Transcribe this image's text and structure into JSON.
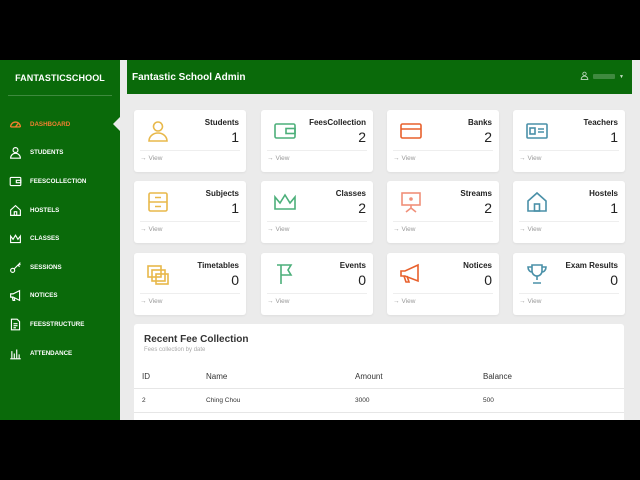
{
  "sidebar": {
    "brand": "FANTASTICSCHOOL",
    "items": [
      {
        "label": "DASHBOARD",
        "icon": "dashboard-gauge-icon",
        "active": true
      },
      {
        "label": "STUDENTS",
        "icon": "user-icon"
      },
      {
        "label": "FEESCOLLECTION",
        "icon": "wallet-icon"
      },
      {
        "label": "HOSTELS",
        "icon": "home-icon"
      },
      {
        "label": "CLASSES",
        "icon": "crown-icon"
      },
      {
        "label": "SESSIONS",
        "icon": "key-icon"
      },
      {
        "label": "NOTICES",
        "icon": "megaphone-icon"
      },
      {
        "label": "FEESSTRUCTURE",
        "icon": "document-icon"
      },
      {
        "label": "ATTENDANCE",
        "icon": "bar-chart-icon"
      }
    ]
  },
  "header": {
    "title": "Fantastic School Admin",
    "user_icon": "user-icon",
    "caret_icon": "caret-down-icon"
  },
  "colors": {
    "brand_green": "#0a6a0a",
    "active_orange": "#f08030",
    "yellow": "#e8b84a",
    "green": "#4caf7a",
    "orange": "#e8602c",
    "salmon": "#f0907a",
    "teal": "#4a90a8"
  },
  "cards": [
    {
      "label": "Students",
      "value": "1",
      "icon": "student-icon",
      "view": "View"
    },
    {
      "label": "FeesCollection",
      "value": "2",
      "icon": "wallet-icon",
      "view": "View"
    },
    {
      "label": "Banks",
      "value": "2",
      "icon": "credit-card-icon",
      "view": "View"
    },
    {
      "label": "Teachers",
      "value": "1",
      "icon": "id-card-icon",
      "view": "View"
    },
    {
      "label": "Subjects",
      "value": "1",
      "icon": "drawer-icon",
      "view": "View"
    },
    {
      "label": "Classes",
      "value": "2",
      "icon": "crown-icon",
      "view": "View"
    },
    {
      "label": "Streams",
      "value": "2",
      "icon": "easel-icon",
      "view": "View"
    },
    {
      "label": "Hostels",
      "value": "1",
      "icon": "home-icon",
      "view": "View"
    },
    {
      "label": "Timetables",
      "value": "0",
      "icon": "copy-icon",
      "view": "View"
    },
    {
      "label": "Events",
      "value": "0",
      "icon": "flag-icon",
      "view": "View"
    },
    {
      "label": "Notices",
      "value": "0",
      "icon": "megaphone-icon",
      "view": "View"
    },
    {
      "label": "Exam Results",
      "value": "0",
      "icon": "trophy-icon",
      "view": "View"
    }
  ],
  "recent": {
    "title": "Recent Fee Collection",
    "subtitle": "Fees collection by date",
    "columns": [
      "ID",
      "Name",
      "Amount",
      "Balance"
    ],
    "rows": [
      {
        "id": "2",
        "name": "Ching Chou",
        "amount": "3000",
        "balance": "500"
      }
    ]
  }
}
